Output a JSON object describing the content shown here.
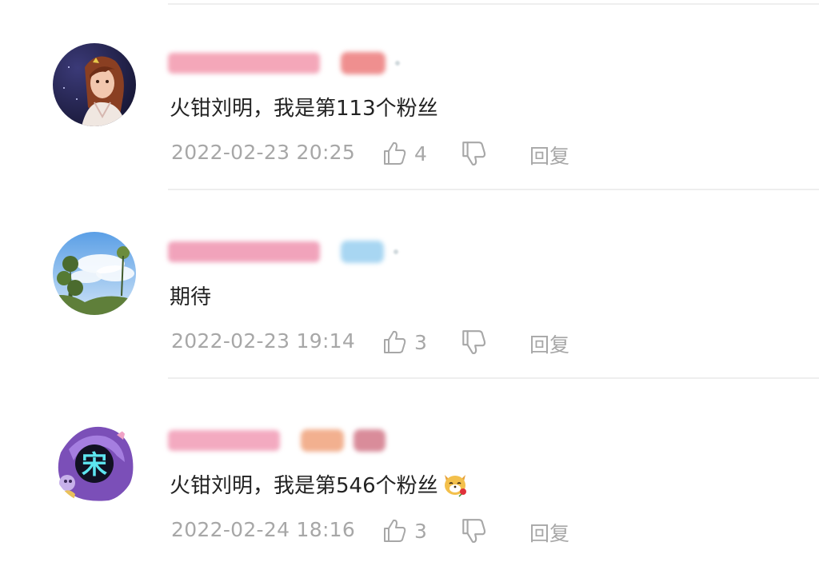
{
  "comments": [
    {
      "text": "火钳刘明，我是第113个粉丝",
      "time": "2022-02-23 20:25",
      "likes": "4",
      "reply_label": "回复",
      "avatar_icon": "anime-girl-avatar"
    },
    {
      "text": "期待",
      "time": "2022-02-23 19:14",
      "likes": "3",
      "reply_label": "回复",
      "avatar_icon": "sky-trees-avatar"
    },
    {
      "text": "火钳刘明，我是第546个粉丝",
      "time": "2022-02-24 18:16",
      "likes": "3",
      "reply_label": "回复",
      "avatar_icon": "anime-character-avatar",
      "emoji": "dog-rose-emoji"
    }
  ],
  "colors": {
    "text": "#222222",
    "meta": "#a7a7a7",
    "divider": "#eeeeee",
    "username_blur": "#f29bb0"
  }
}
